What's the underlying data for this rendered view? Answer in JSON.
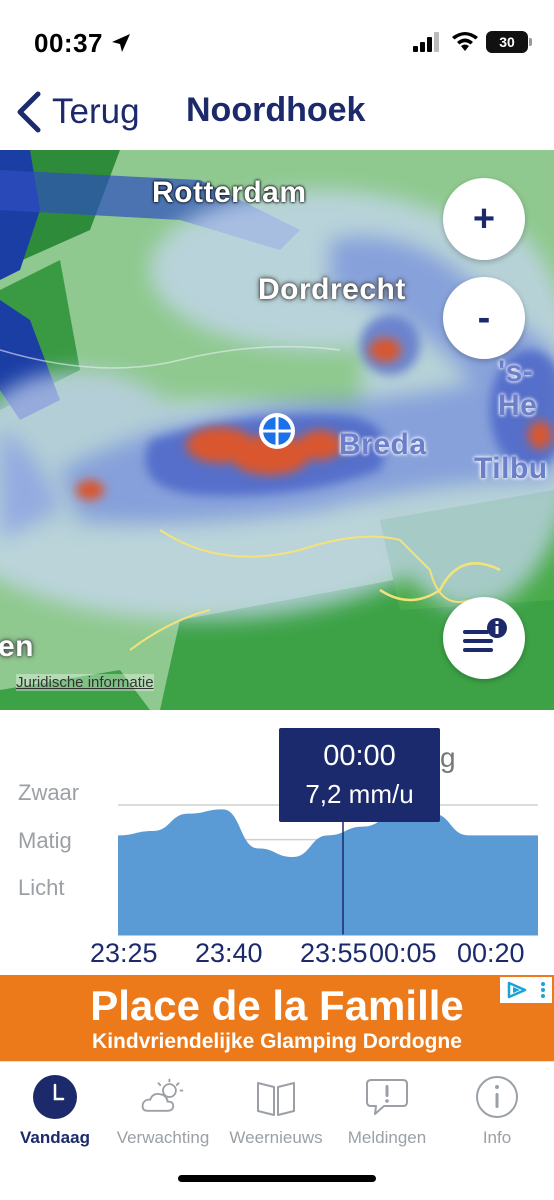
{
  "status_bar": {
    "time": "00:37",
    "battery": "30"
  },
  "nav": {
    "back_label": "Terug",
    "title": "Noordhoek"
  },
  "map": {
    "cities": [
      "Rotterdam",
      "Dordrecht",
      "Breda",
      "Tilbu",
      "'s-He",
      "en"
    ],
    "zoom_in": "+",
    "zoom_out": "-",
    "legal": "Juridische informatie"
  },
  "chart": {
    "tooltip": {
      "time": "00:00",
      "value": "7,2 mm/u"
    },
    "partial_label": "g"
  },
  "chart_data": {
    "type": "area",
    "ylabels": [
      "Zwaar",
      "Matig",
      "Licht"
    ],
    "xlabels": [
      "23:25",
      "23:40",
      "23:55",
      "00:05",
      "00:20"
    ],
    "x": [
      "23:25",
      "23:30",
      "23:35",
      "23:40",
      "23:45",
      "23:50",
      "23:55",
      "00:00",
      "00:05",
      "00:10",
      "00:15",
      "00:20",
      "00:25"
    ],
    "values": [
      2.3,
      2.4,
      2.8,
      2.9,
      2.0,
      1.8,
      2.3,
      2.5,
      2.8,
      2.8,
      2.3,
      2.3,
      2.3
    ],
    "ylim": [
      0,
      3.3
    ],
    "color": "#5b9bd5",
    "grid": true
  },
  "ad": {
    "title": "Place de la Famille",
    "subtitle": "Kindvriendelijke Glamping Dordogne"
  },
  "tabs": [
    {
      "label": "Vandaag",
      "icon": "clock-icon",
      "active": true
    },
    {
      "label": "Verwachting",
      "icon": "cloud-sun-icon",
      "active": false
    },
    {
      "label": "Weernieuws",
      "icon": "book-icon",
      "active": false
    },
    {
      "label": "Meldingen",
      "icon": "alert-bubble-icon",
      "active": false
    },
    {
      "label": "Info",
      "icon": "info-icon",
      "active": false
    }
  ],
  "colors": {
    "brand": "#1c2a6b",
    "accent": "#ec7a1b",
    "rain": "#5b9bd5"
  }
}
